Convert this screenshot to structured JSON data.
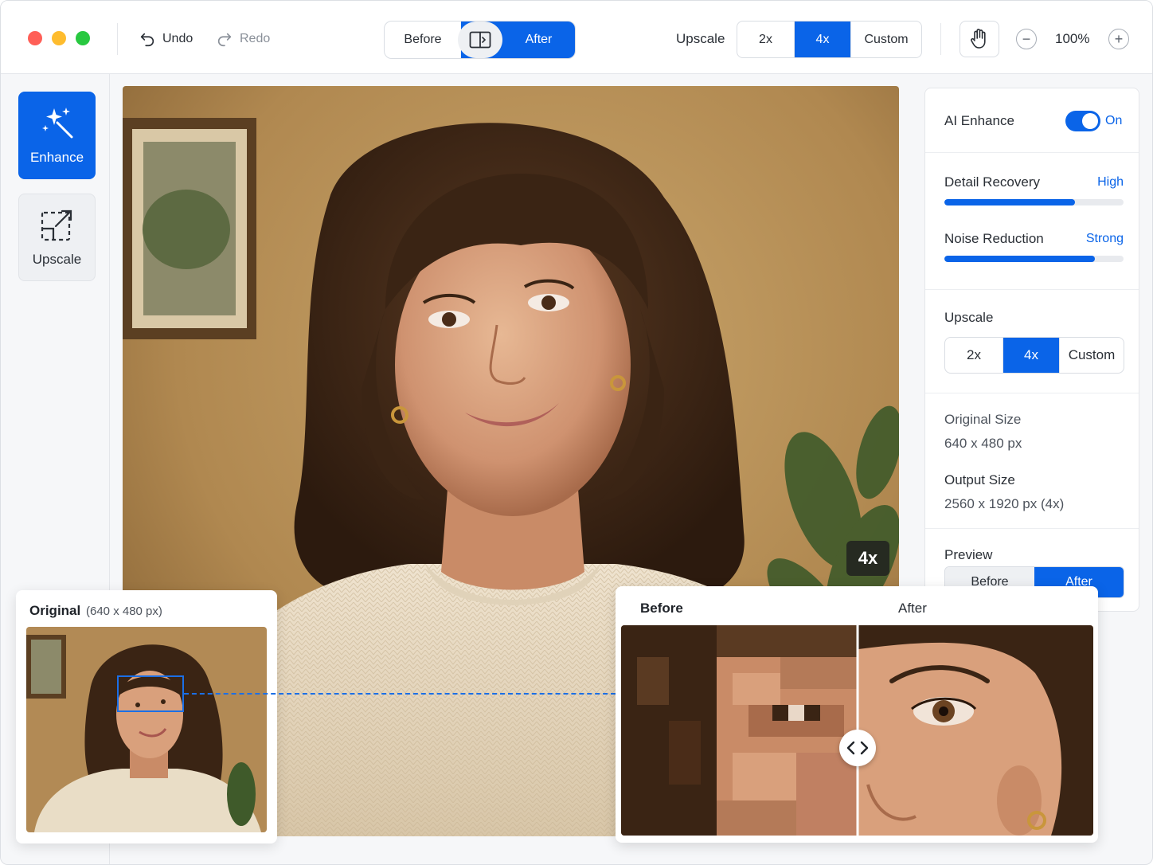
{
  "toolbar": {
    "undo_label": "Undo",
    "redo_label": "Redo",
    "compare": {
      "before_label": "Before",
      "after_label": "After"
    },
    "upscale_label": "Upscale",
    "scale_options": [
      "2x",
      "4x",
      "Custom"
    ],
    "scale_selected": "4x",
    "zoom": "100%"
  },
  "rail": {
    "enhance_label": "Enhance",
    "upscale_label": "Upscale"
  },
  "canvas": {
    "scale_badge": "4x"
  },
  "panel": {
    "ai_enhance": {
      "label": "AI Enhance",
      "state": "On"
    },
    "detail_recovery": {
      "label": "Detail Recovery",
      "value": "High",
      "level": 0.73
    },
    "noise_reduction": {
      "label": "Noise Reduction",
      "value": "Strong",
      "level": 0.84
    },
    "upscale": {
      "label": "Upscale",
      "options": [
        "2x",
        "4x",
        "Custom"
      ],
      "selected": "4x"
    },
    "original_size": {
      "label": "Original Size",
      "value": "640 x 480 px"
    },
    "output_size": {
      "label": "Output Size",
      "value": "2560 x 1920 px (4x)"
    },
    "preview": {
      "label": "Preview",
      "before_label": "Before",
      "after_label": "After",
      "selected": "After"
    }
  },
  "original_card": {
    "title": "Original",
    "dimensions": "(640 x 480 px)"
  },
  "compare_card": {
    "before_label": "Before",
    "after_label": "After"
  },
  "colors": {
    "accent": "#0a64e8",
    "traffic_red": "#ff5f57",
    "traffic_yellow": "#febc2e",
    "traffic_green": "#28c840"
  }
}
